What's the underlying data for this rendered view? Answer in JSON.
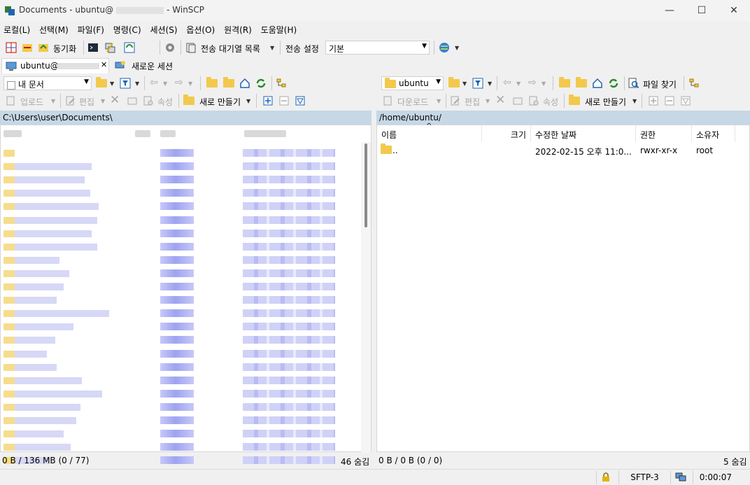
{
  "window": {
    "title": "Documents - ubuntu@",
    "title_suffix": "- WinSCP",
    "minimize": "—",
    "maximize": "☐",
    "close": "✕"
  },
  "menu": [
    "로컬(L)",
    "선택(M)",
    "파일(F)",
    "명령(C)",
    "세션(S)",
    "옵션(O)",
    "원격(R)",
    "도움말(H)"
  ],
  "toolbar": {
    "sync_label": "동기화",
    "queue_label": "전송 대기열 목록",
    "transfer_settings_label": "전송 설정",
    "transfer_preset": "기본"
  },
  "tabs": {
    "session_label": "ubuntu@",
    "new_session_label": "새로운 세션"
  },
  "local": {
    "location": "내 문서",
    "upload": "업로드",
    "edit": "편집",
    "properties": "속성",
    "new": "새로 만들기",
    "path": "C:\\Users\\user\\Documents\\",
    "status_left": "0 B / 136 MB (0 / 77)",
    "status_right": "46 숨김"
  },
  "remote": {
    "location": "ubuntu",
    "download": "다운로드",
    "edit": "편집",
    "properties": "속성",
    "new": "새로 만들기",
    "find_files": "파일 찾기",
    "path": "/home/ubuntu/",
    "columns": [
      "이름",
      "크기",
      "수정한 날짜",
      "권한",
      "소유자"
    ],
    "rows": [
      {
        "name": "..",
        "size": "",
        "modified": "2022-02-15 오후 11:0...",
        "rights": "rwxr-xr-x",
        "owner": "root"
      }
    ],
    "status_left": "0 B / 0 B (0 / 0)",
    "status_right": "5 숨김"
  },
  "statusbar": {
    "protocol": "SFTP-3",
    "time": "0:00:07"
  },
  "colors": {
    "path_bar": "#c6d7e6",
    "folder": "#f2c94c",
    "selection_blur": "#c9c9f5"
  }
}
